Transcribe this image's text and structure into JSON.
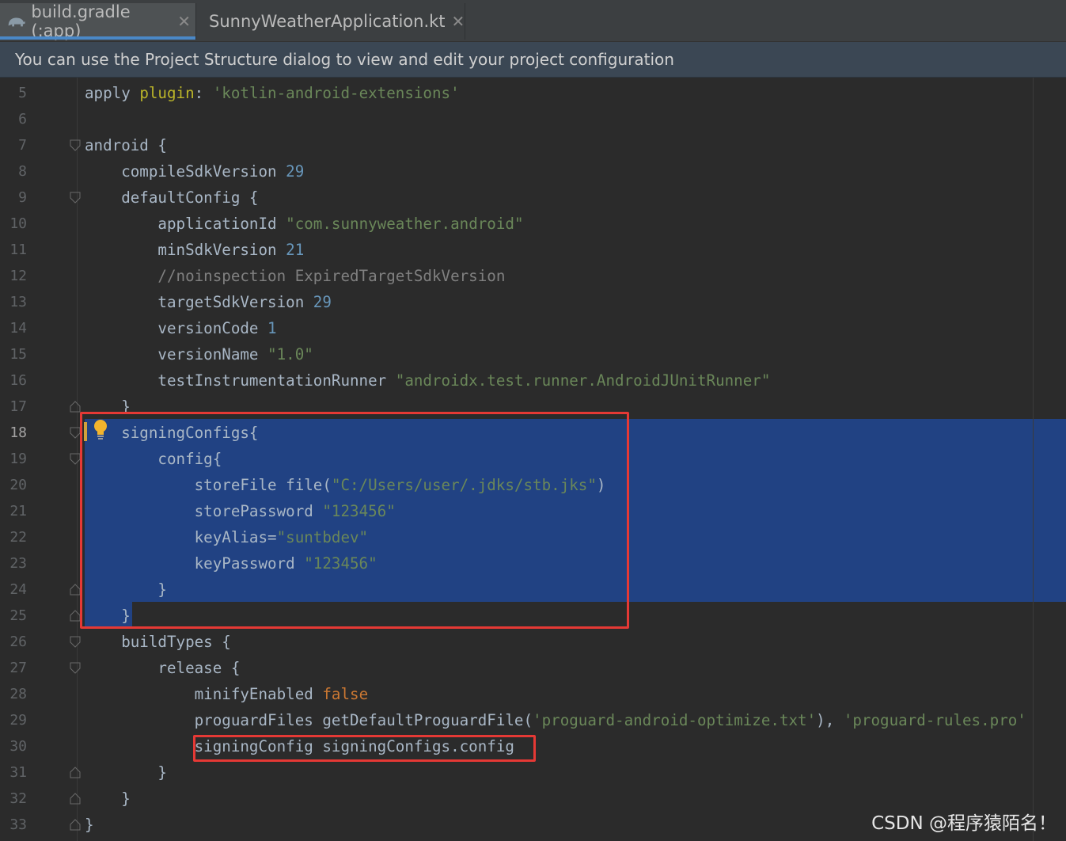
{
  "tabs": [
    {
      "label": "build.gradle (:app)",
      "icon": "gradle-elephant-icon",
      "active": true
    },
    {
      "label": "SunnyWeatherApplication.kt",
      "icon": "kotlin-file-icon",
      "active": false
    }
  ],
  "banner": {
    "text": "You can use the Project Structure dialog to view and edit your project configuration"
  },
  "editor": {
    "current_line": 18,
    "lines": [
      {
        "n": "5",
        "tokens": [
          [
            "apply ",
            "text"
          ],
          [
            "plugin",
            "plug2"
          ],
          [
            ": ",
            "text"
          ],
          [
            "'kotlin-android-extensions'",
            "str"
          ]
        ]
      },
      {
        "n": "6",
        "tokens": []
      },
      {
        "n": "7",
        "tokens": [
          [
            "android {",
            "text"
          ]
        ]
      },
      {
        "n": "8",
        "tokens": [
          [
            "    compileSdkVersion ",
            "text"
          ],
          [
            "29",
            "num"
          ]
        ]
      },
      {
        "n": "9",
        "tokens": [
          [
            "    defaultConfig {",
            "text"
          ]
        ]
      },
      {
        "n": "10",
        "tokens": [
          [
            "        applicationId ",
            "text"
          ],
          [
            "\"com.sunnyweather.android\"",
            "str"
          ]
        ]
      },
      {
        "n": "11",
        "tokens": [
          [
            "        minSdkVersion ",
            "text"
          ],
          [
            "21",
            "num"
          ]
        ]
      },
      {
        "n": "12",
        "tokens": [
          [
            "        //noinspection ExpiredTargetSdkVersion",
            "com"
          ]
        ]
      },
      {
        "n": "13",
        "tokens": [
          [
            "        targetSdkVersion ",
            "text"
          ],
          [
            "29",
            "num"
          ]
        ]
      },
      {
        "n": "14",
        "tokens": [
          [
            "        versionCode ",
            "text"
          ],
          [
            "1",
            "num"
          ]
        ]
      },
      {
        "n": "15",
        "tokens": [
          [
            "        versionName ",
            "text"
          ],
          [
            "\"1.0\"",
            "str"
          ]
        ]
      },
      {
        "n": "16",
        "tokens": [
          [
            "        testInstrumentationRunner ",
            "text"
          ],
          [
            "\"androidx.test.runner.AndroidJUnitRunner\"",
            "str"
          ]
        ]
      },
      {
        "n": "17",
        "tokens": [
          [
            "    }",
            "text"
          ]
        ]
      },
      {
        "n": "18",
        "tokens": [
          [
            "    signingConfigs{",
            "text"
          ]
        ]
      },
      {
        "n": "19",
        "tokens": [
          [
            "        config{",
            "text"
          ]
        ]
      },
      {
        "n": "20",
        "tokens": [
          [
            "            storeFile file(",
            "text"
          ],
          [
            "\"C:/Users/user/.jdks/stb.jks\"",
            "str"
          ],
          [
            ")",
            "text"
          ]
        ]
      },
      {
        "n": "21",
        "tokens": [
          [
            "            storePassword ",
            "text"
          ],
          [
            "\"123456\"",
            "str"
          ]
        ]
      },
      {
        "n": "22",
        "tokens": [
          [
            "            keyAlias=",
            "text"
          ],
          [
            "\"suntbdev\"",
            "str"
          ]
        ]
      },
      {
        "n": "23",
        "tokens": [
          [
            "            keyPassword ",
            "text"
          ],
          [
            "\"123456\"",
            "str"
          ]
        ]
      },
      {
        "n": "24",
        "tokens": [
          [
            "        }",
            "text"
          ]
        ]
      },
      {
        "n": "25",
        "tokens": [
          [
            "    }",
            "text"
          ]
        ]
      },
      {
        "n": "26",
        "tokens": [
          [
            "    buildTypes {",
            "text"
          ]
        ]
      },
      {
        "n": "27",
        "tokens": [
          [
            "        release {",
            "text"
          ]
        ]
      },
      {
        "n": "28",
        "tokens": [
          [
            "            minifyEnabled ",
            "text"
          ],
          [
            "false",
            "kw"
          ]
        ]
      },
      {
        "n": "29",
        "tokens": [
          [
            "            proguardFiles getDefaultProguardFile(",
            "text"
          ],
          [
            "'proguard-android-optimize.txt'",
            "str"
          ],
          [
            "), ",
            "text"
          ],
          [
            "'proguard-rules.pro'",
            "str"
          ]
        ]
      },
      {
        "n": "30",
        "tokens": [
          [
            "            signingConfig signingConfigs.config",
            "text"
          ]
        ]
      },
      {
        "n": "31",
        "tokens": [
          [
            "        }",
            "text"
          ]
        ]
      },
      {
        "n": "32",
        "tokens": [
          [
            "    }",
            "text"
          ]
        ]
      },
      {
        "n": "33",
        "tokens": [
          [
            "}",
            "text"
          ]
        ]
      }
    ]
  },
  "colors": {
    "selection": "#214283",
    "annotation_box": "#e53935",
    "string": "#6a8759",
    "number": "#6897bb",
    "keyword": "#cc7832",
    "comment": "#808080",
    "text": "#a9b7c6"
  },
  "watermark": "CSDN @程序猿陌名！"
}
